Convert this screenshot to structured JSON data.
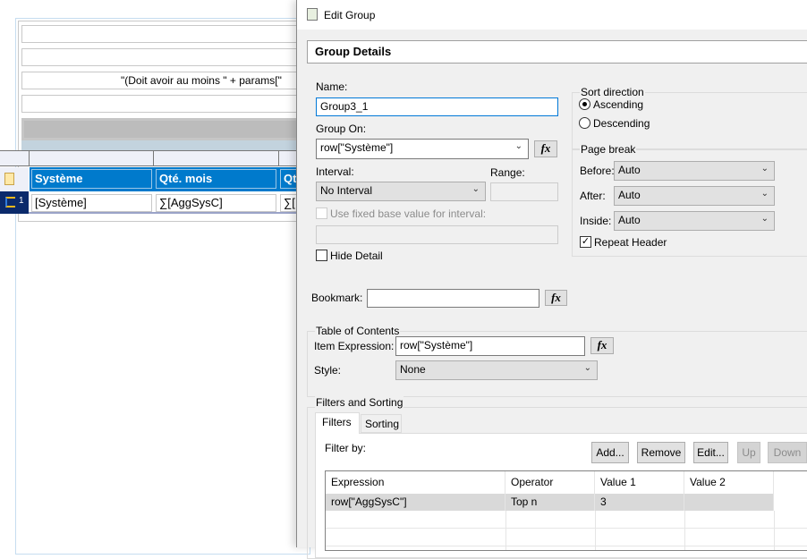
{
  "report": {
    "expression_text": "\"(Doit avoir au moins \" + params[\"",
    "header_cells": [
      "Système",
      "Qté. mois",
      "Qt"
    ],
    "detail_cells": [
      "[Système]",
      "∑[AggSysC]",
      "∑["
    ],
    "group_level": "1",
    "colors": {
      "header_blue": "#007acc",
      "row_handle": "#0b2a6b"
    }
  },
  "dialog": {
    "title": "Edit Group",
    "section_title": "Group Details",
    "name_label": "Name:",
    "name_value": "Group3_1",
    "group_on_label": "Group On:",
    "group_on_value": "row[\"Système\"]",
    "fx_label": "fx",
    "interval_label": "Interval:",
    "interval_value": "No Interval",
    "range_label": "Range:",
    "range_value": "",
    "fixed_base_label": "Use fixed base value for interval:",
    "fixed_base_checked": false,
    "hide_detail_label": "Hide Detail",
    "hide_detail_checked": false,
    "sort_direction": {
      "title": "Sort direction",
      "ascending": "Ascending",
      "descending": "Descending",
      "selected": "Ascending"
    },
    "page_break": {
      "title": "Page break",
      "before_label": "Before:",
      "before_value": "Auto",
      "after_label": "After:",
      "after_value": "Auto",
      "inside_label": "Inside:",
      "inside_value": "Auto",
      "repeat_header_label": "Repeat Header",
      "repeat_header_checked": true
    },
    "bookmark_label": "Bookmark:",
    "bookmark_value": "",
    "toc": {
      "title": "Table of Contents",
      "item_expression_label": "Item Expression:",
      "item_expression_value": "row[\"Système\"]",
      "style_label": "Style:",
      "style_value": "None"
    },
    "filters_sorting": {
      "title": "Filters and Sorting",
      "tabs": [
        "Filters",
        "Sorting"
      ],
      "active_tab": "Filters",
      "filter_by_label": "Filter by:",
      "buttons": {
        "add": "Add...",
        "remove": "Remove",
        "edit": "Edit...",
        "up": "Up",
        "down": "Down"
      },
      "columns": [
        "Expression",
        "Operator",
        "Value 1",
        "Value 2"
      ],
      "rows": [
        [
          "row[\"AggSysC\"]",
          "Top n",
          "3",
          ""
        ]
      ]
    }
  }
}
